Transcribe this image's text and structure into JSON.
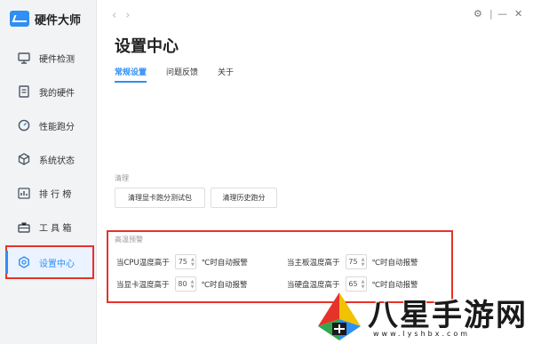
{
  "brand": {
    "name": "硬件大师"
  },
  "sidebar": {
    "items": [
      {
        "label": "硬件检测",
        "icon": "monitor-icon"
      },
      {
        "label": "我的硬件",
        "icon": "document-icon"
      },
      {
        "label": "性能跑分",
        "icon": "speedometer-icon"
      },
      {
        "label": "系统状态",
        "icon": "cube-icon"
      },
      {
        "label": "排 行 榜",
        "icon": "ranking-icon"
      },
      {
        "label": "工 具 箱",
        "icon": "toolbox-icon"
      },
      {
        "label": "设置中心",
        "icon": "settings-hex-icon"
      }
    ]
  },
  "nav": {
    "back": "‹",
    "forward": "›"
  },
  "window": {
    "settings": "⚙",
    "minimize": "—",
    "close": "✕"
  },
  "page": {
    "title": "设置中心"
  },
  "tabs": [
    {
      "label": "常规设置"
    },
    {
      "label": "问题反馈"
    },
    {
      "label": "关于"
    }
  ],
  "clean": {
    "title": "清理",
    "btn1": "清理显卡跑分测试包",
    "btn2": "清理历史跑分"
  },
  "alert": {
    "title": "高温预警",
    "cpu": {
      "label": "当CPU温度高于",
      "value": "75",
      "suffix": "℃时自动报警"
    },
    "board": {
      "label": "当主板温度高于",
      "value": "75",
      "suffix": "℃时自动报警"
    },
    "gpu": {
      "label": "当显卡温度高于",
      "value": "80",
      "suffix": "℃时自动报警"
    },
    "disk": {
      "label": "当硬盘温度高于",
      "value": "65",
      "suffix": "℃时自动报警"
    }
  },
  "watermark": {
    "text": "八星手游网",
    "url": "www.lyshbx.com"
  },
  "colors": {
    "accent": "#2f8ff2",
    "highlight": "#e6332a"
  }
}
